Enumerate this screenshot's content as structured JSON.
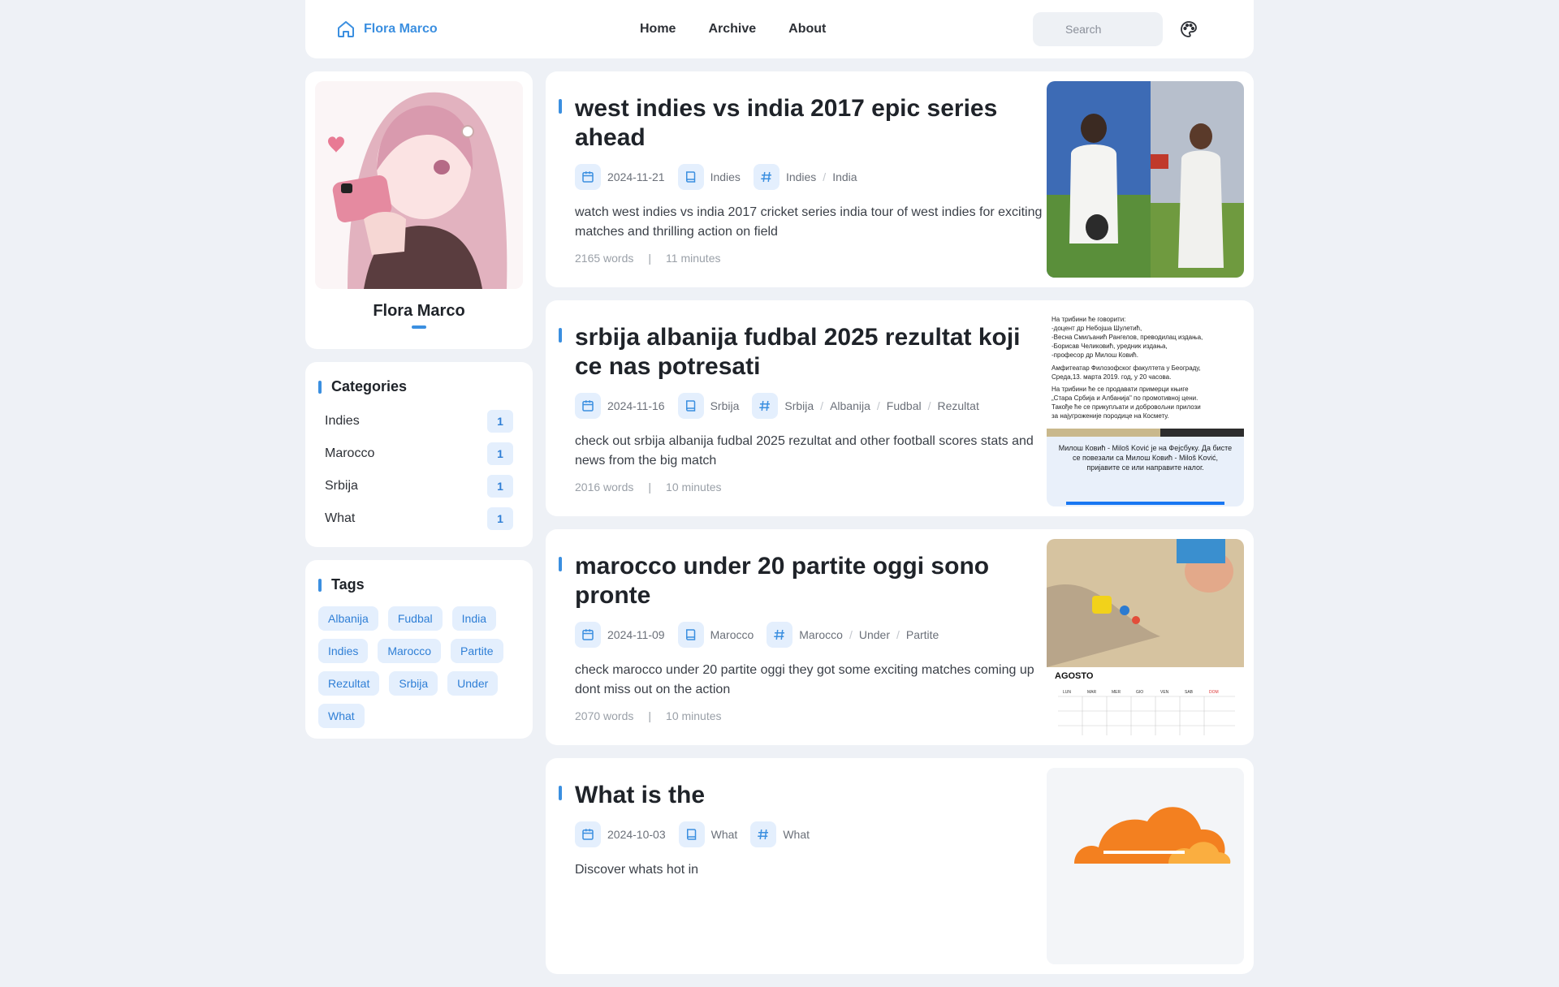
{
  "nav": {
    "brand": "Flora Marco",
    "links": [
      "Home",
      "Archive",
      "About"
    ],
    "search_placeholder": "Search"
  },
  "profile": {
    "name": "Flora Marco"
  },
  "categories": {
    "title": "Categories",
    "items": [
      {
        "name": "Indies",
        "count": "1"
      },
      {
        "name": "Marocco",
        "count": "1"
      },
      {
        "name": "Srbija",
        "count": "1"
      },
      {
        "name": "What",
        "count": "1"
      }
    ]
  },
  "tags": {
    "title": "Tags",
    "items": [
      "Albanija",
      "Fudbal",
      "India",
      "Indies",
      "Marocco",
      "Partite",
      "Rezultat",
      "Srbija",
      "Under",
      "What"
    ]
  },
  "posts": [
    {
      "title": "west indies vs india 2017 epic series ahead",
      "date": "2024-11-21",
      "category": "Indies",
      "tags": [
        "Indies",
        "India"
      ],
      "excerpt": "watch west indies vs india 2017 cricket series india tour of west indies for exciting matches and thrilling action on field",
      "words": "2165 words",
      "minutes": "11 minutes"
    },
    {
      "title": "srbija albanija fudbal 2025 rezultat koji ce nas potresati",
      "date": "2024-11-16",
      "category": "Srbija",
      "tags": [
        "Srbija",
        "Albanija",
        "Fudbal",
        "Rezultat"
      ],
      "excerpt": "check out srbija albanija fudbal 2025 rezultat and other football scores stats and news from the big match",
      "words": "2016 words",
      "minutes": "10 minutes",
      "thumb_text": {
        "lines": [
          "На трибини ће говорити:",
          "-доцент др Небојша Шулетић,",
          "-Весна Смиљанић Рангелов, преводилац издања,",
          "-Борисав Челиковић, уредник издања,",
          "-професор др Милош Ковић.",
          "Амфитеатар Филозофског факултета у Београду,",
          "Среда,13. марта 2019. год, у 20 часова.",
          "На трибини ће се продавати примерци књиге",
          "„Стара Србија и Албанија\" по промотивној цени.",
          "Такође ће се прикупљати и добровољни прилози",
          "за најугроженије породице на Космету."
        ],
        "popup": "Милош Ковић - Miloš Ković је на Фејсбуку. Да бисте се повезали са Милош Ковић - Miloš Ković, пријавите се или направите налог."
      }
    },
    {
      "title": "marocco under 20 partite oggi sono pronte",
      "date": "2024-11-09",
      "category": "Marocco",
      "tags": [
        "Marocco",
        "Under",
        "Partite"
      ],
      "excerpt": "check marocco under 20 partite oggi they got some exciting matches coming up dont miss out on the action",
      "words": "2070 words",
      "minutes": "10 minutes",
      "thumb_text": {
        "month": "AGOSTO",
        "days": [
          "LUN",
          "MAR",
          "MER",
          "GIO",
          "VEN",
          "SAB",
          "DOM"
        ]
      }
    },
    {
      "title": "What is the",
      "date": "2024-10-03",
      "category": "What",
      "tags": [
        "What"
      ],
      "excerpt": "Discover whats hot in",
      "words": "",
      "minutes": ""
    }
  ],
  "colors": {
    "accent": "#3b8fe0",
    "chip_bg": "#e4effd",
    "page_bg": "#eef1f6"
  }
}
